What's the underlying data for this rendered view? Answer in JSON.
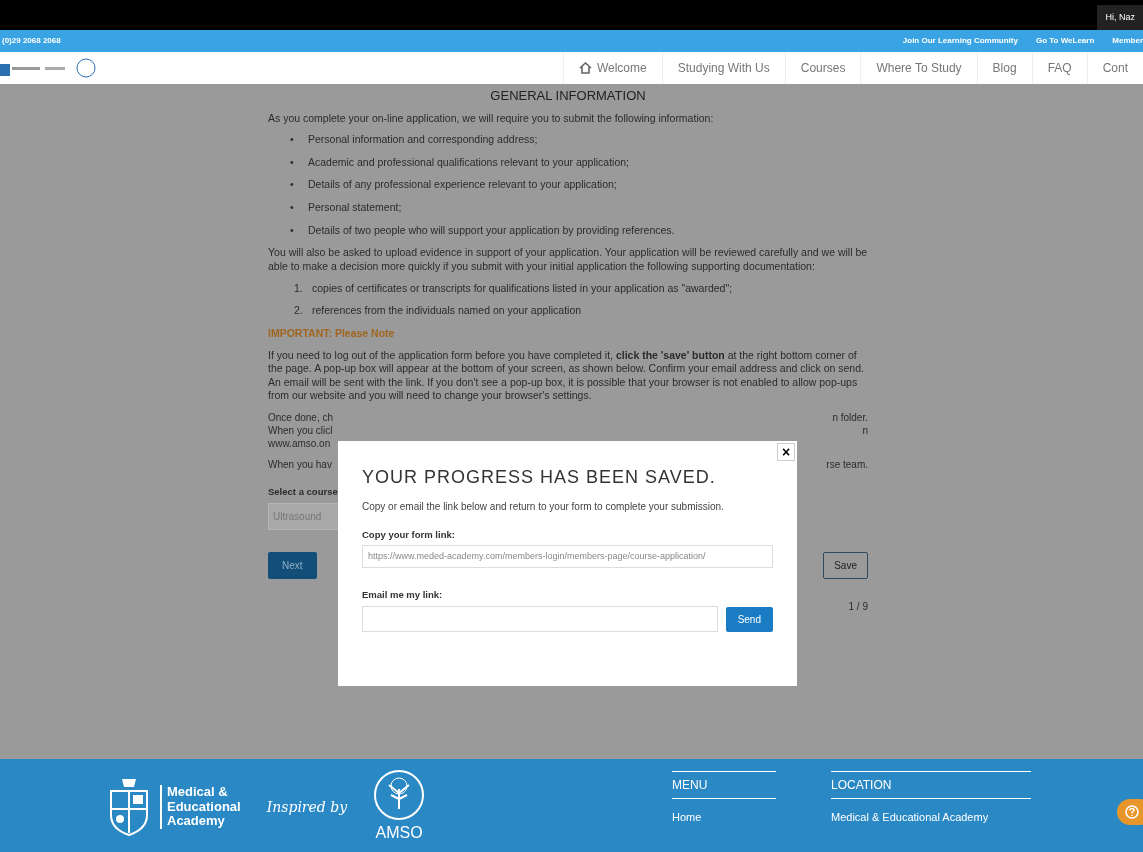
{
  "top_bar": {
    "greeting": "Hi, Naz"
  },
  "contact_bar": {
    "phone": "(0)29 2068 2068",
    "links": [
      "Join Our Learning Community",
      "Go To WeLearn",
      "Member"
    ]
  },
  "navbar": {
    "items": [
      {
        "label": "Welcome",
        "kind": "home"
      },
      {
        "label": "Studying With Us",
        "kind": "text"
      },
      {
        "label": "Courses",
        "kind": "text"
      },
      {
        "label": "Where To Study",
        "kind": "text"
      },
      {
        "label": "Blog",
        "kind": "text"
      },
      {
        "label": "FAQ",
        "kind": "text"
      },
      {
        "label": "Cont",
        "kind": "text"
      }
    ]
  },
  "content": {
    "heading": "GENERAL INFORMATION",
    "intro": "As you complete your on-line application, we will require you to submit the following information:",
    "bullets": [
      {
        "marker": "•",
        "text": "Personal information and corresponding address;"
      },
      {
        "marker": "•",
        "text": "Academic and professional qualifications relevant to your application;"
      },
      {
        "marker": "•",
        "text": "Details of any professional experience relevant to your application;"
      },
      {
        "marker": "•",
        "text": "Personal statement;"
      },
      {
        "marker": "•",
        "text": "Details of two people who will support your application by providing references."
      }
    ],
    "upload_text": "You will also be asked to upload evidence in support of your application. Your application will be reviewed carefully and we will be able to make a decision more quickly if you submit with your initial application the following supporting documentation:",
    "documents": [
      {
        "marker": "1.",
        "text": "copies of certificates or transcripts for qualifications listed in your application as \"awarded\";"
      },
      {
        "marker": "2.",
        "text": "references from the individuals named on your application"
      }
    ],
    "important": "IMPORTANT: Please Note",
    "note": "If you need to log out of the application form before you have completed it, **click the 'save' button** at the right bottom corner of the page. A pop-up box will appear at the bottom of your screen, as shown below. Confirm your email address and click on send. An email will be sent with the link. If you don't see a pop-up box, it is possible that your browser is not enabled to allow pop-ups from our website and you will need to change your browser's settings.",
    "partial_lines": [
      {
        "left": "Once done, ch",
        "right": "n folder."
      },
      {
        "left": "When you clicl",
        "right": "n"
      },
      {
        "left": "www.amso.on"
      }
    ],
    "last_line": {
      "left": "When you hav",
      "right": "rse team."
    },
    "course_label": "Select a course",
    "course_value": "Ultrasound",
    "next_button": "Next",
    "save_button": "Save",
    "page_indicator": "1 / 9"
  },
  "modal": {
    "close": "×",
    "title": "YOUR PROGRESS HAS BEEN SAVED.",
    "text": "Copy or email the link below and return to your form to complete your submission.",
    "link_label": "Copy your form link:",
    "link_value": "https://www.meded-academy.com/members-login/members-page/course-application/",
    "email_label": "Email me my link:",
    "send_button": "Send"
  },
  "footer": {
    "logo_text": [
      "Medical &",
      "Educational",
      "Academy"
    ],
    "inspired": "Inspired by",
    "amso": "AMSO",
    "menu_heading": "MENU",
    "menu_items": [
      "Home"
    ],
    "location_heading": "LOCATION",
    "location_lines": [
      "Medical & Educational Academy"
    ]
  }
}
